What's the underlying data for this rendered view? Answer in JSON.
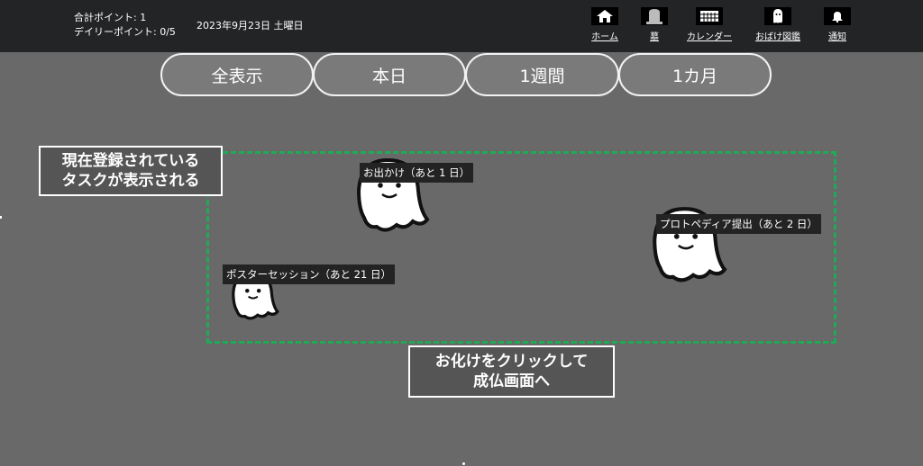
{
  "header": {
    "total_points": "合計ポイント: 1",
    "daily_points": "デイリーポイント: 0/5",
    "date": "2023年9月23日 土曜日",
    "nav": [
      {
        "label": "ホーム",
        "icon": "home-icon"
      },
      {
        "label": "墓",
        "icon": "tombstone-icon"
      },
      {
        "label": "カレンダー",
        "icon": "calendar-icon"
      },
      {
        "label": "おばけ図鑑",
        "icon": "ghost-icon"
      },
      {
        "label": "通知",
        "icon": "bell-icon"
      }
    ]
  },
  "filters": [
    "全表示",
    "本日",
    "1週間",
    "1カ月"
  ],
  "notes": {
    "tasks_line1": "現在登録されている",
    "tasks_line2": "タスクが表示される",
    "click_line1": "お化けをクリックして",
    "click_line2": "成仏画面へ"
  },
  "ghosts": [
    {
      "label": "お出かけ（あと 1 日）"
    },
    {
      "label": "プロトペディア提出（あと 2 日）"
    },
    {
      "label": "ポスターセッション（あと 21 日）"
    }
  ],
  "colors": {
    "background": "#696969",
    "header": "#222426",
    "dashed_border": "#1faa55"
  }
}
